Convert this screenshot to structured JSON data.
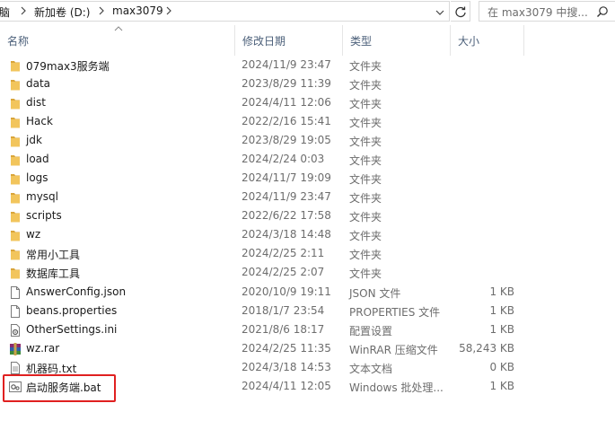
{
  "address": {
    "crumbs": [
      "脑",
      "新加卷 (D:)",
      "max3079"
    ],
    "search_placeholder": "在 max3079 中搜..."
  },
  "columns": {
    "name": "名称",
    "modified": "修改日期",
    "type": "类型",
    "size": "大小"
  },
  "files": [
    {
      "name": "079max3服务端",
      "modified": "2024/11/9 23:47",
      "type": "文件夹",
      "size": "",
      "icon": "folder-icon"
    },
    {
      "name": "data",
      "modified": "2023/8/29 11:39",
      "type": "文件夹",
      "size": "",
      "icon": "folder-icon"
    },
    {
      "name": "dist",
      "modified": "2024/4/11 12:06",
      "type": "文件夹",
      "size": "",
      "icon": "folder-icon"
    },
    {
      "name": "Hack",
      "modified": "2022/2/16 15:41",
      "type": "文件夹",
      "size": "",
      "icon": "folder-icon"
    },
    {
      "name": "jdk",
      "modified": "2023/8/29 19:05",
      "type": "文件夹",
      "size": "",
      "icon": "folder-icon"
    },
    {
      "name": "load",
      "modified": "2024/2/24 0:03",
      "type": "文件夹",
      "size": "",
      "icon": "folder-icon"
    },
    {
      "name": "logs",
      "modified": "2024/11/7 19:09",
      "type": "文件夹",
      "size": "",
      "icon": "folder-icon"
    },
    {
      "name": "mysql",
      "modified": "2024/11/9 23:47",
      "type": "文件夹",
      "size": "",
      "icon": "folder-icon"
    },
    {
      "name": "scripts",
      "modified": "2022/6/22 17:58",
      "type": "文件夹",
      "size": "",
      "icon": "folder-icon"
    },
    {
      "name": "wz",
      "modified": "2024/3/18 14:48",
      "type": "文件夹",
      "size": "",
      "icon": "folder-icon"
    },
    {
      "name": "常用小工具",
      "modified": "2024/2/25 2:11",
      "type": "文件夹",
      "size": "",
      "icon": "folder-icon"
    },
    {
      "name": "数据库工具",
      "modified": "2024/2/25 2:07",
      "type": "文件夹",
      "size": "",
      "icon": "folder-icon"
    },
    {
      "name": "AnswerConfig.json",
      "modified": "2020/10/9 19:11",
      "type": "JSON 文件",
      "size": "1 KB",
      "icon": "document-icon"
    },
    {
      "name": "beans.properties",
      "modified": "2018/1/7 23:54",
      "type": "PROPERTIES 文件",
      "size": "1 KB",
      "icon": "document-icon"
    },
    {
      "name": "OtherSettings.ini",
      "modified": "2021/8/6 18:17",
      "type": "配置设置",
      "size": "1 KB",
      "icon": "settings-file-icon"
    },
    {
      "name": "wz.rar",
      "modified": "2024/2/25 11:35",
      "type": "WinRAR 压缩文件",
      "size": "58,243 KB",
      "icon": "winrar-icon"
    },
    {
      "name": "机器码.txt",
      "modified": "2024/3/18 14:53",
      "type": "文本文档",
      "size": "0 KB",
      "icon": "text-file-icon"
    },
    {
      "name": "启动服务端.bat",
      "modified": "2024/4/11 12:05",
      "type": "Windows 批处理...",
      "size": "1 KB",
      "icon": "batch-file-icon"
    }
  ],
  "colors": {
    "folder": "#f2c55c",
    "folder_dark": "#d9a53a",
    "highlight": "#e02020",
    "header_text": "#4c607a"
  }
}
